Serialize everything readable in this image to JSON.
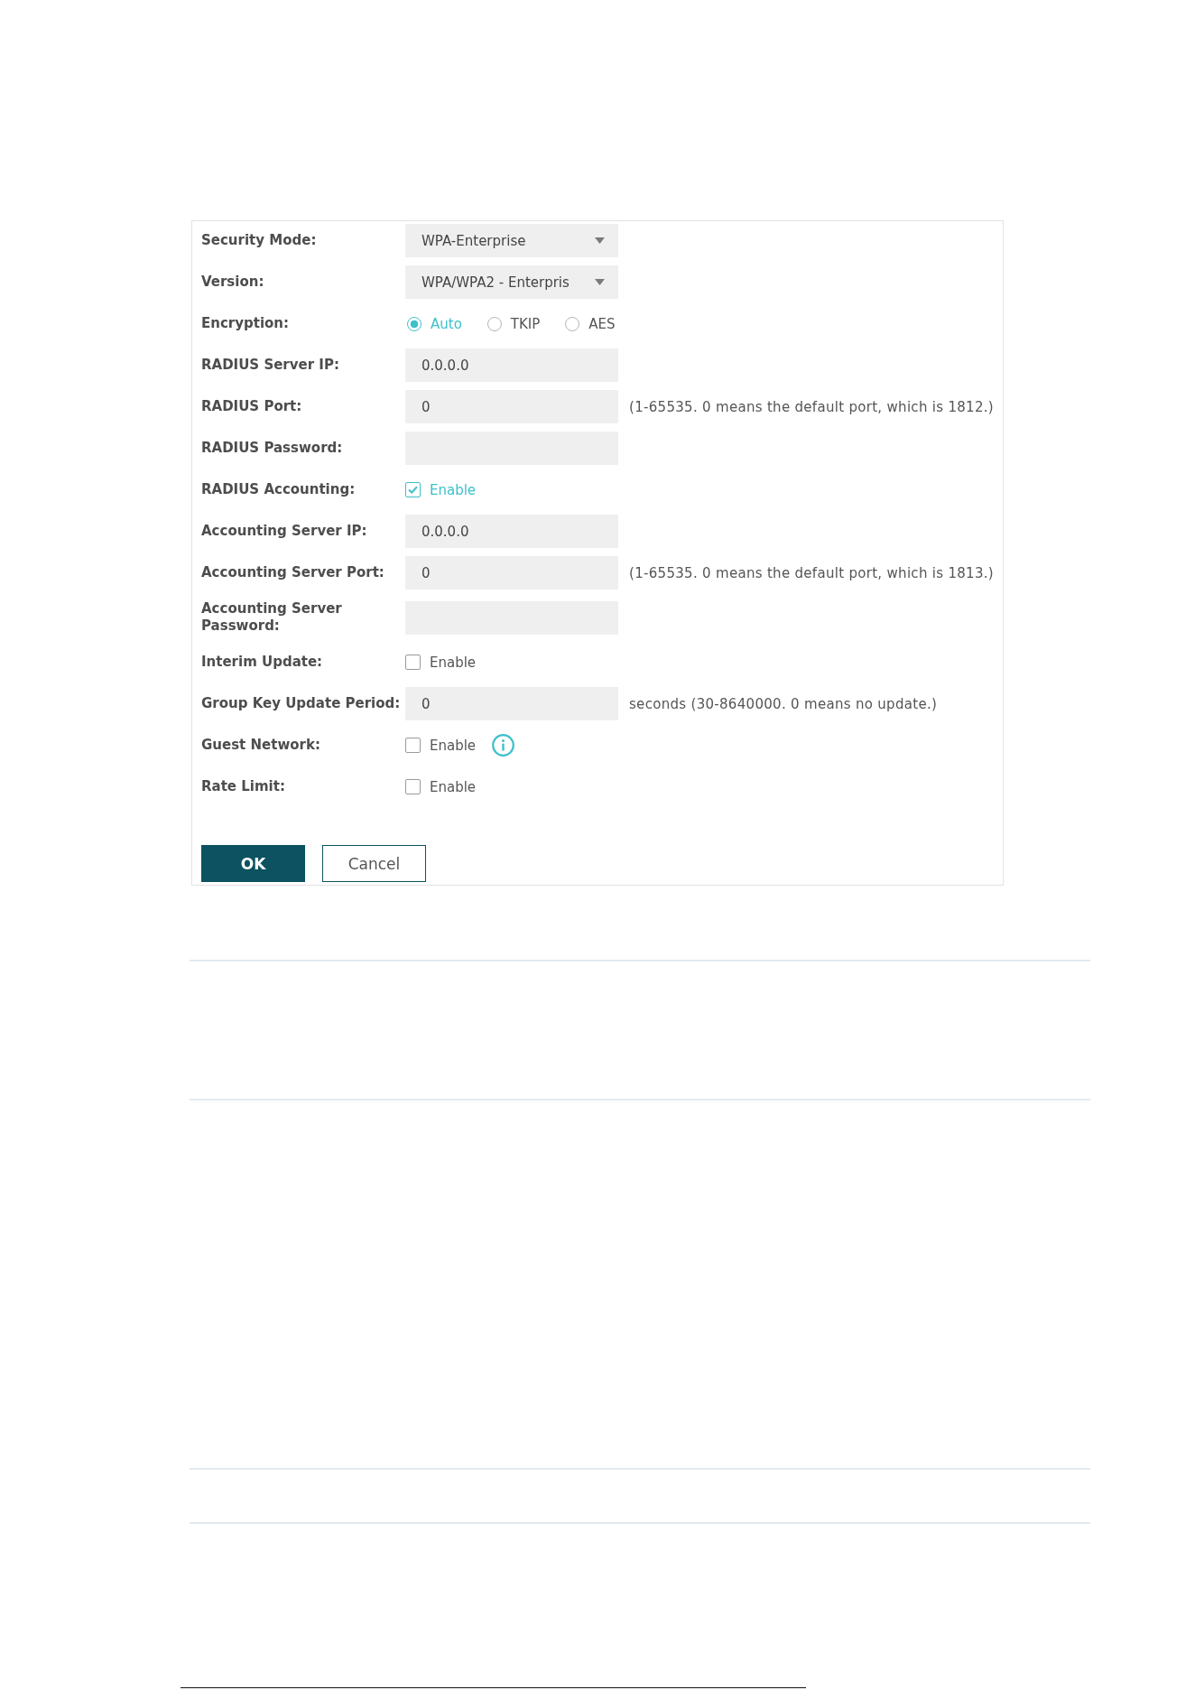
{
  "form": {
    "rows": [
      {
        "kind": "select",
        "label": "Security Mode:",
        "value": "WPA-Enterprise"
      },
      {
        "kind": "select",
        "label": "Version:",
        "value": "WPA/WPA2 - Enterpris"
      },
      {
        "kind": "radio",
        "label": "Encryption:",
        "options": [
          {
            "label": "Auto",
            "selected": true
          },
          {
            "label": "TKIP",
            "selected": false
          },
          {
            "label": "AES",
            "selected": false
          }
        ]
      },
      {
        "kind": "text",
        "label": "RADIUS Server IP:",
        "value": "0.0.0.0"
      },
      {
        "kind": "text",
        "label": "RADIUS Port:",
        "value": "0",
        "hint": "(1-65535. 0 means the default port, which is 1812.)"
      },
      {
        "kind": "text",
        "label": "RADIUS Password:"
      },
      {
        "kind": "checkbox",
        "label": "RADIUS Accounting:",
        "option": "Enable",
        "checked": true
      },
      {
        "kind": "text",
        "label": "Accounting Server IP:",
        "value": "0.0.0.0"
      },
      {
        "kind": "text",
        "label": "Accounting Server Port:",
        "value": "0",
        "hint": "(1-65535. 0 means the default port, which is 1813.)"
      },
      {
        "kind": "text",
        "label": "Accounting Server Password:"
      },
      {
        "kind": "checkbox",
        "label": "Interim Update:",
        "option": "Enable",
        "checked": false
      },
      {
        "kind": "text",
        "label": "Group Key Update Period:",
        "value": "0",
        "hint": "seconds (30-8640000. 0 means no update.)"
      },
      {
        "kind": "checkbox",
        "label": "Guest Network:",
        "option": "Enable",
        "checked": false,
        "info": true
      },
      {
        "kind": "checkbox",
        "label": "Rate Limit:",
        "option": "Enable",
        "checked": false
      }
    ],
    "buttons": [
      {
        "kind": "primary",
        "label": "OK"
      },
      {
        "kind": "secondary",
        "label": "Cancel"
      }
    ]
  }
}
